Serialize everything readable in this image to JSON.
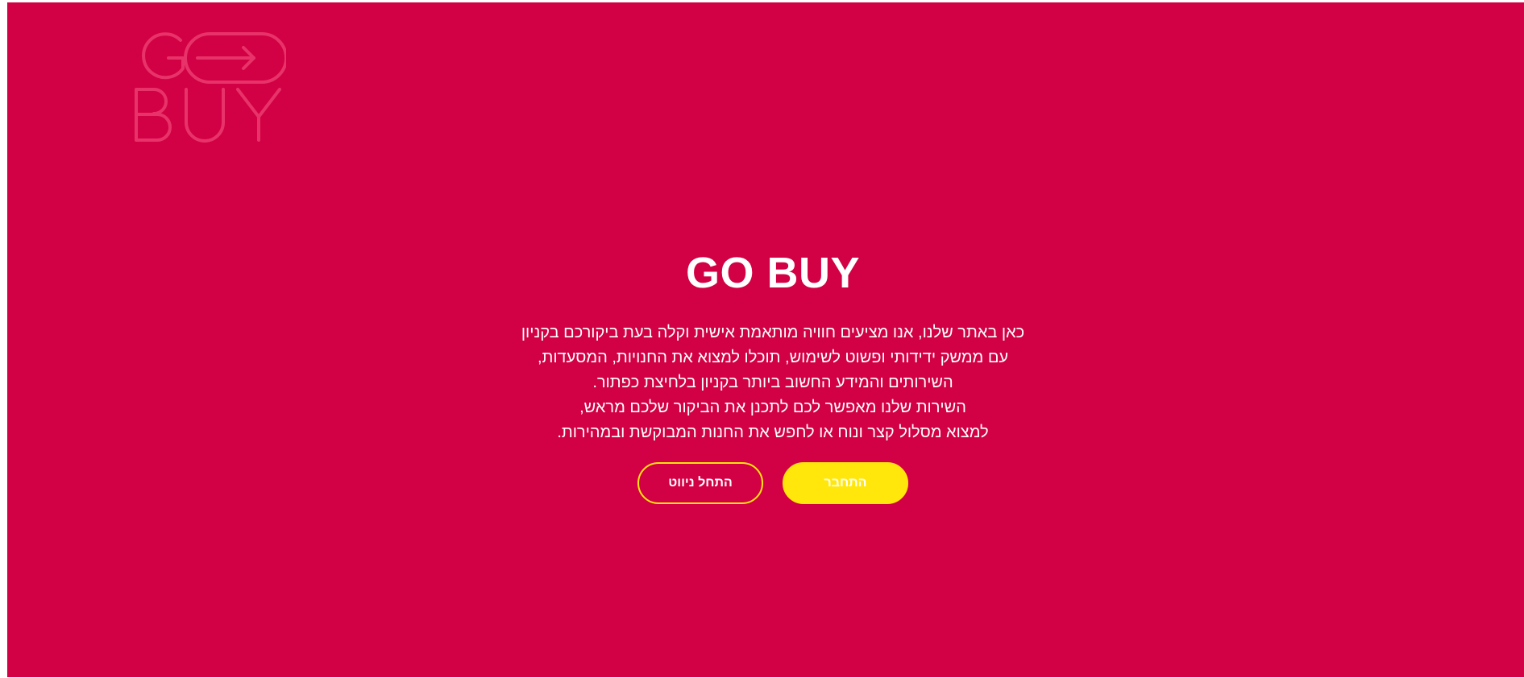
{
  "colors": {
    "background": "#d20044",
    "accent": "#ffe70b",
    "logo": "#e8336a",
    "text": "#ffffff"
  },
  "logo": {
    "line1": "GO",
    "line2": "BUY",
    "icon": "arrow-right-icon"
  },
  "hero": {
    "title": "GO BUY",
    "lines": [
      "כאן באתר שלנו, אנו מציעים חוויה מותאמת אישית וקלה בעת ביקורכם בקניון",
      "עם ממשק ידידותי ופשוט לשימוש, תוכלו למצוא את החנויות, המסעדות,",
      "השירותים והמידע החשוב ביותר בקניון בלחיצת כפתור.",
      "השירות שלנו מאפשר לכם לתכנן את הביקור שלכם מראש,",
      "למצוא מסלול קצר ונוח או לחפש את החנות המבוקשת ובמהירות."
    ]
  },
  "actions": {
    "start_navigation_label": "התחל ניווט",
    "login_label": "התחבר"
  }
}
